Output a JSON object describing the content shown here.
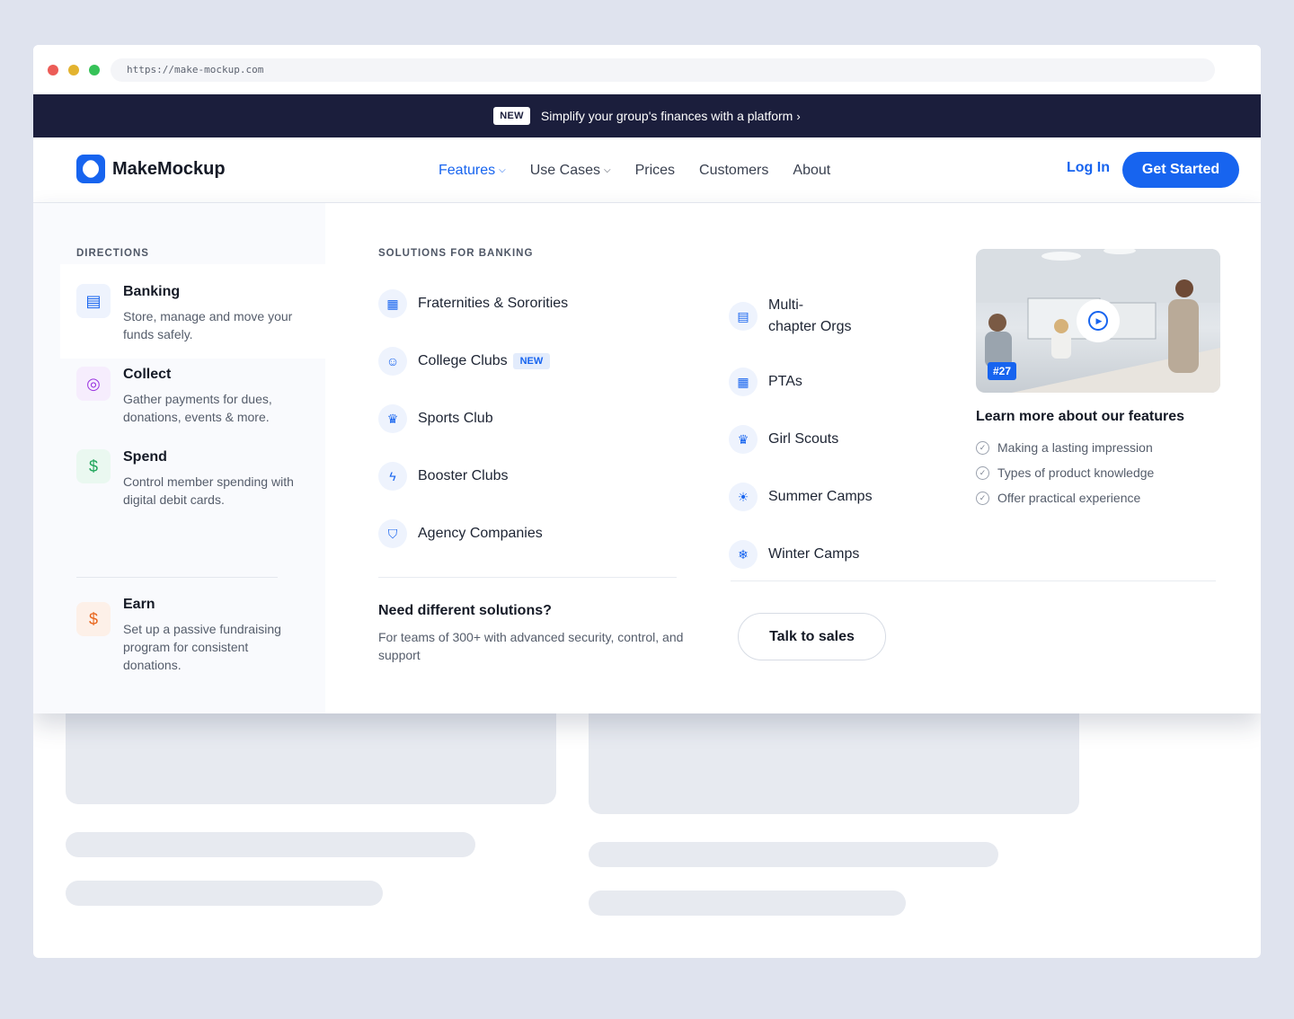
{
  "browser": {
    "url": "https://make-mockup.com"
  },
  "banner": {
    "badge": "NEW",
    "text": "Simplify your group's finances with a platform",
    "arrow": "›"
  },
  "nav": {
    "brand": "MakeMockup",
    "items": [
      {
        "label": "Features",
        "has_chevron": true,
        "active": true
      },
      {
        "label": "Use Cases",
        "has_chevron": true,
        "active": false
      },
      {
        "label": "Prices",
        "has_chevron": false,
        "active": false
      },
      {
        "label": "Customers",
        "has_chevron": false,
        "active": false
      },
      {
        "label": "About",
        "has_chevron": false,
        "active": false
      }
    ],
    "chevron": "⌵",
    "login": "Log In",
    "cta": "Get Started"
  },
  "directions": {
    "label": "DIRECTIONS",
    "items": [
      {
        "title": "Banking",
        "desc": "Store, manage and move your funds safely.",
        "icon": "bank-icon",
        "glyph": "▤",
        "color": "#1764ef",
        "bg": "#eef3fd"
      },
      {
        "title": "Collect",
        "desc": "Gather payments for dues, donations, events & more.",
        "icon": "coins-icon",
        "glyph": "◎",
        "color": "#9b34e0",
        "bg": "#f6edfd"
      },
      {
        "title": "Spend",
        "desc": "Control member spending with digital debit cards.",
        "icon": "dollar-icon",
        "glyph": "$",
        "color": "#1ea55a",
        "bg": "#eaf8f0"
      },
      {
        "title": "Earn",
        "desc": "Set up a passive fundraising program for consistent donations.",
        "icon": "dollar-circle-icon",
        "glyph": "$",
        "color": "#e8651c",
        "bg": "#fdf0e8"
      }
    ]
  },
  "solutions": {
    "label": "SOLUTIONS FOR BANKING",
    "left": [
      {
        "label": "Fraternities & Sororities",
        "icon": "building-icon",
        "glyph": "▦"
      },
      {
        "label": "College Clubs",
        "icon": "users-icon",
        "glyph": "☺",
        "tag": "NEW"
      },
      {
        "label": "Sports Club",
        "icon": "trophy-icon",
        "glyph": "♛"
      },
      {
        "label": "Booster Clubs",
        "icon": "bolt-icon",
        "glyph": "ϟ"
      },
      {
        "label": "Agency Companies",
        "icon": "shield-icon",
        "glyph": "⛉"
      }
    ],
    "right": [
      {
        "label_line1": "Multi-",
        "label_line2": "chapter Orgs",
        "icon": "building-icon",
        "glyph": "▤"
      },
      {
        "label": "PTAs",
        "icon": "building-icon",
        "glyph": "▦"
      },
      {
        "label": "Girl Scouts",
        "icon": "trophy-icon",
        "glyph": "♛"
      },
      {
        "label": "Summer Camps",
        "icon": "sun-icon",
        "glyph": "☀"
      },
      {
        "label": "Winter Camps",
        "icon": "snowflake-icon",
        "glyph": "❄"
      }
    ],
    "need_title": "Need different solutions?",
    "need_desc": "For teams of 300+ with advanced security, control, and support",
    "talk_cta": "Talk to sales"
  },
  "learn": {
    "badge": "#27",
    "title": "Learn more about our features",
    "items": [
      "Making a lasting impression",
      "Types of product knowledge",
      "Offer practical experience"
    ],
    "check_glyph": "✓"
  },
  "colors": {
    "accent": "#1764ef",
    "banner": "#1b1e3c"
  }
}
